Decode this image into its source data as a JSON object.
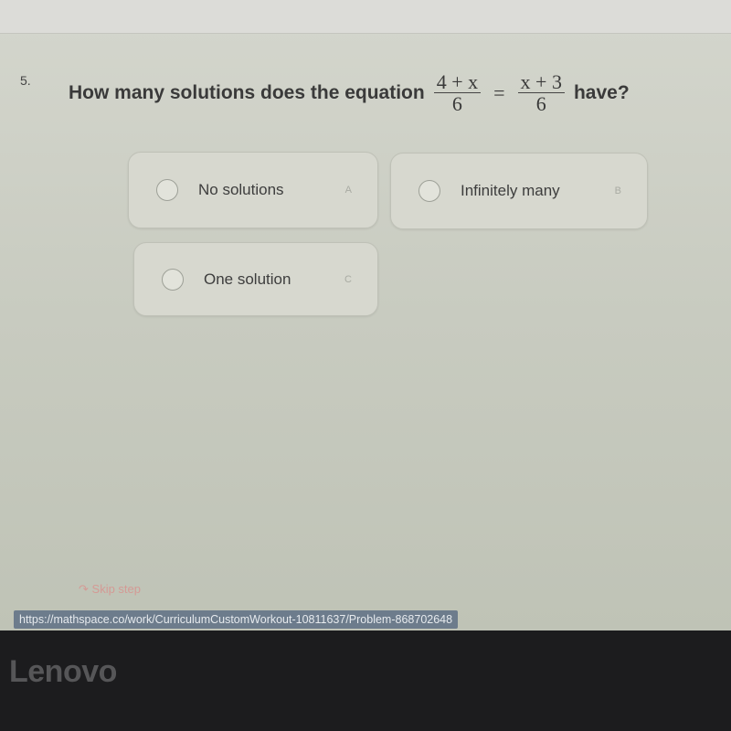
{
  "question": {
    "number": "5.",
    "prefix": "How many solutions does the equation",
    "lhs_numerator": "4 + x",
    "lhs_denominator": "6",
    "equals": "=",
    "rhs_numerator": "x + 3",
    "rhs_denominator": "6",
    "suffix": "have?"
  },
  "options": [
    {
      "label": "No solutions",
      "letter": "A",
      "selected": false
    },
    {
      "label": "Infinitely many",
      "letter": "B",
      "selected": false
    },
    {
      "label": "One solution",
      "letter": "C",
      "selected": false
    }
  ],
  "skip": {
    "icon": "skip-arrow-icon",
    "label": "Skip step"
  },
  "status_url": "https://mathspace.co/work/CurriculumCustomWorkout-10811637/Problem-868702648",
  "bezel_logo": "Lenovo"
}
